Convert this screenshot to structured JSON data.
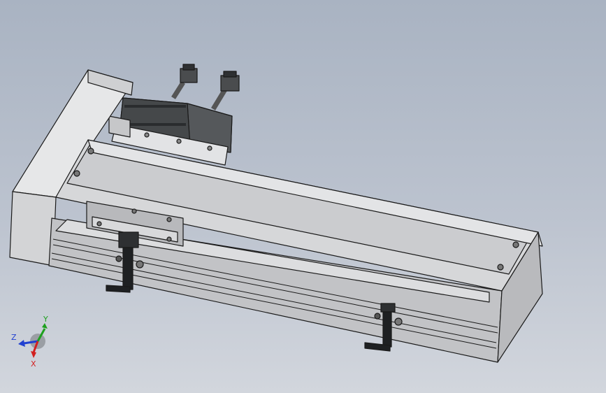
{
  "viewport": {
    "background_top": "#a9b3c2",
    "background_bottom": "#d2d6dd"
  },
  "model": {
    "parts": [
      "motor",
      "motor-bracket",
      "cable-connector",
      "cable-connector",
      "end-cap",
      "linear-module-body",
      "carriage-slider",
      "limit-sensor",
      "limit-sensor"
    ],
    "colors": {
      "body_light": "#d8d9db",
      "body_top": "#cfd0d2",
      "body_side": "#b9babd",
      "motor_dark": "#3e4042",
      "edge": "#1a1a1a"
    }
  },
  "triad": {
    "x_label": "X",
    "y_label": "Y",
    "z_label": "Z",
    "x_color": "#d22020",
    "y_color": "#1ea01e",
    "z_color": "#2040d0"
  }
}
